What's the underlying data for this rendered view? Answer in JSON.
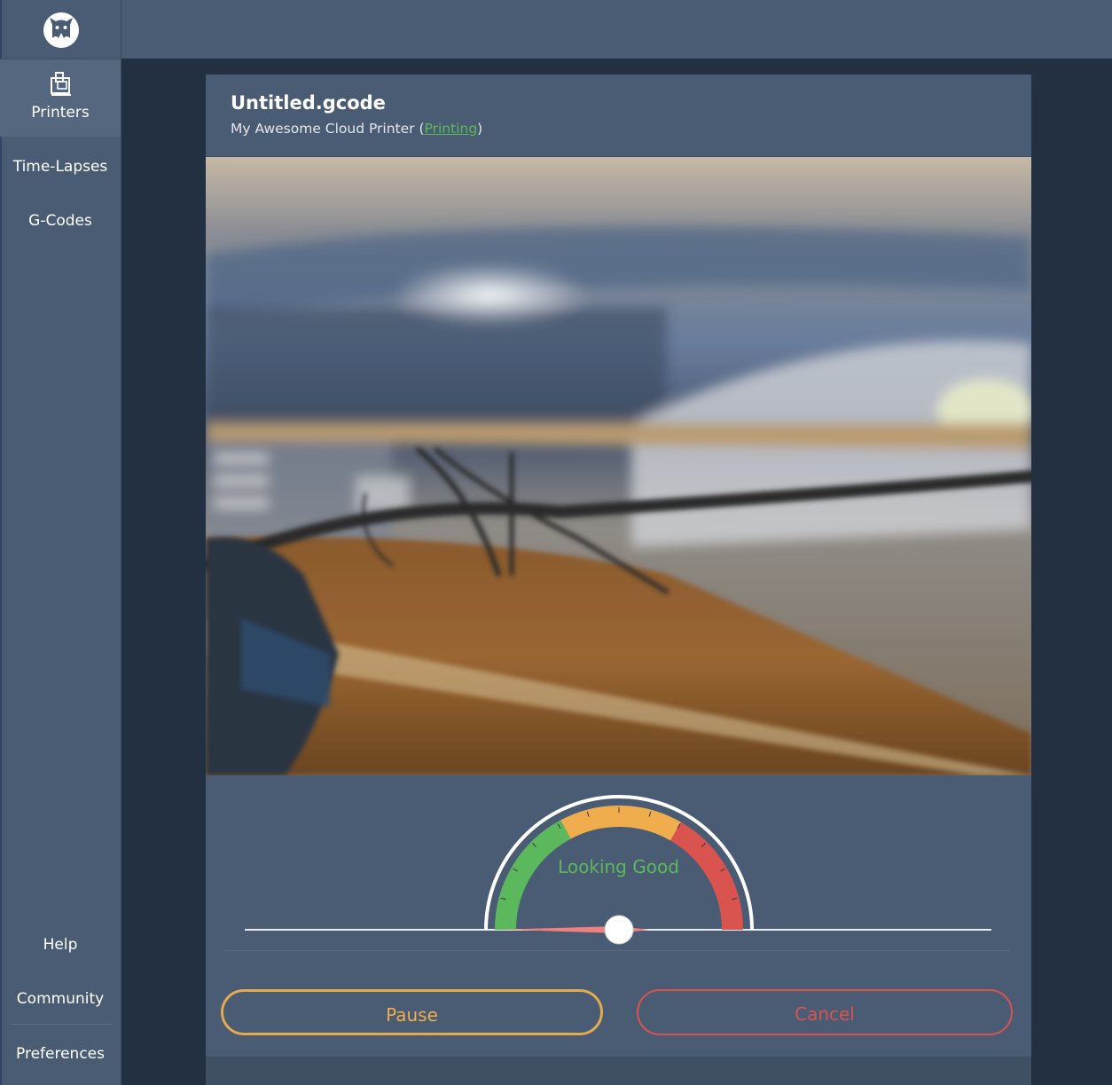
{
  "sidebar": {
    "logo_icon": "octocat-logo-icon",
    "items": [
      {
        "label": "Printers",
        "icon": "printer-icon",
        "active": true
      },
      {
        "label": "Time-Lapses"
      },
      {
        "label": "G-Codes"
      }
    ],
    "bottom_items": [
      {
        "label": "Help"
      },
      {
        "label": "Community"
      },
      {
        "label": "Preferences"
      }
    ]
  },
  "print": {
    "filename": "Untitled.gcode",
    "printer_name": "My Awesome Cloud Printer",
    "status": "Printing"
  },
  "gauge": {
    "label": "Looking Good",
    "level": 0.0,
    "zones": [
      {
        "name": "good",
        "color": "#5cb85c"
      },
      {
        "name": "fair",
        "color": "#f0ad4e"
      },
      {
        "name": "bad",
        "color": "#d9534f"
      }
    ]
  },
  "actions": {
    "pause_label": "Pause",
    "cancel_label": "Cancel"
  },
  "colors": {
    "success": "#5cb85c",
    "warning": "#f0ad4e",
    "danger": "#d9534f"
  }
}
